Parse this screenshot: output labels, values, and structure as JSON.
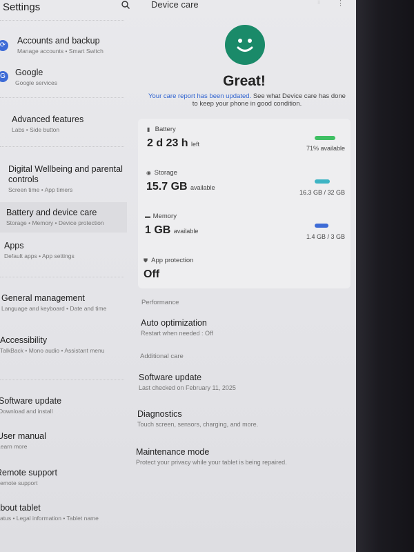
{
  "left_panel": {
    "title": "Settings",
    "items": [
      {
        "title": "Accounts and backup",
        "subtitle": "Manage accounts  •  Smart Switch"
      },
      {
        "title": "Google",
        "subtitle": "Google services"
      },
      {
        "title": "Advanced features",
        "subtitle": "Labs  •  Side button"
      },
      {
        "title": "Digital Wellbeing and parental controls",
        "subtitle": "Screen time  •  App timers"
      },
      {
        "title": "Battery and device care",
        "subtitle": "Storage  •  Memory  •  Device protection"
      },
      {
        "title": "Apps",
        "subtitle": "Default apps  •  App settings"
      },
      {
        "title": "General management",
        "subtitle": "Language and keyboard  •  Date and time"
      },
      {
        "title": "Accessibility",
        "subtitle": "TalkBack  •  Mono audio  •  Assistant menu"
      },
      {
        "title": "Software update",
        "subtitle": "Download and install"
      },
      {
        "title": "User manual",
        "subtitle": "Learn more"
      },
      {
        "title": "Remote support",
        "subtitle": "Remote support"
      },
      {
        "title": "About tablet",
        "subtitle": "Status  •  Legal information  •  Tablet name"
      }
    ]
  },
  "right_panel": {
    "title": "Device care",
    "status_title": "Great!",
    "desc_link": "Your care report has been updated.",
    "desc_rest": "See what Device care has done to keep your phone in good condition.",
    "battery": {
      "label": "Battery",
      "value": "2 d 23 h",
      "unit": "left",
      "right": "71% available"
    },
    "storage": {
      "label": "Storage",
      "value": "15.7 GB",
      "unit": "available",
      "right": "16.3 GB / 32 GB"
    },
    "memory": {
      "label": "Memory",
      "value": "1 GB",
      "unit": "available",
      "right": "1.4 GB / 3 GB"
    },
    "app_protection": {
      "label": "App protection",
      "value": "Off"
    },
    "section_performance": "Performance",
    "auto_opt": {
      "title": "Auto optimization",
      "subtitle": "Restart when needed : Off"
    },
    "section_additional": "Additional care",
    "software_update": {
      "title": "Software update",
      "subtitle": "Last checked on February 11, 2025"
    },
    "diagnostics": {
      "title": "Diagnostics",
      "subtitle": "Touch screen, sensors, charging, and more."
    },
    "maintenance": {
      "title": "Maintenance mode",
      "subtitle": "Protect your privacy while your tablet is being repaired."
    }
  },
  "colors": {
    "battery": "#3fbf63",
    "storage": "#3db4c4",
    "memory": "#3d6bd6",
    "accent": "#1a8a69",
    "link": "#2f63d0"
  }
}
